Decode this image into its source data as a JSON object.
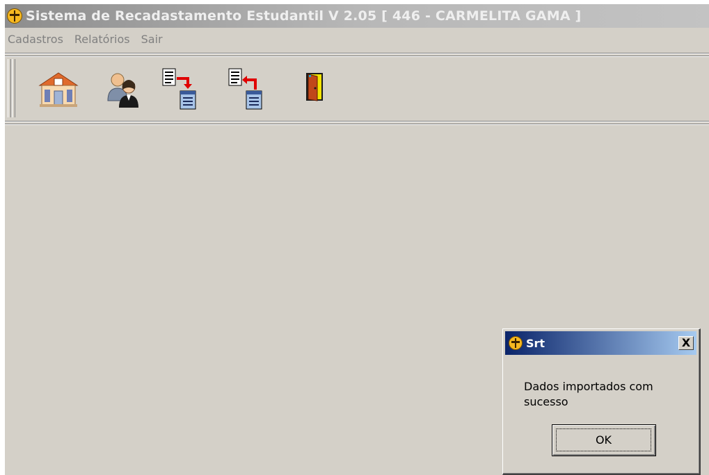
{
  "window": {
    "title": "Sistema de Recadastamento Estudantil V 2.05 [ 446 - CARMELITA GAMA ]"
  },
  "menu": [
    "Cadastros",
    "Relatórios",
    "Sair"
  ],
  "toolbar": {
    "buttons": [
      {
        "icon": "school-icon"
      },
      {
        "icon": "users-icon"
      },
      {
        "icon": "export-data-icon"
      },
      {
        "icon": "import-data-icon"
      },
      {
        "icon": "exit-door-icon"
      }
    ]
  },
  "dialog": {
    "title": "Srt",
    "close_label": "X",
    "message": "Dados importados com sucesso",
    "ok_label": "OK"
  },
  "colors": {
    "window_bg": "#d4d0c8",
    "dialog_title_start": "#0a246a",
    "dialog_title_end": "#a6caf0"
  }
}
